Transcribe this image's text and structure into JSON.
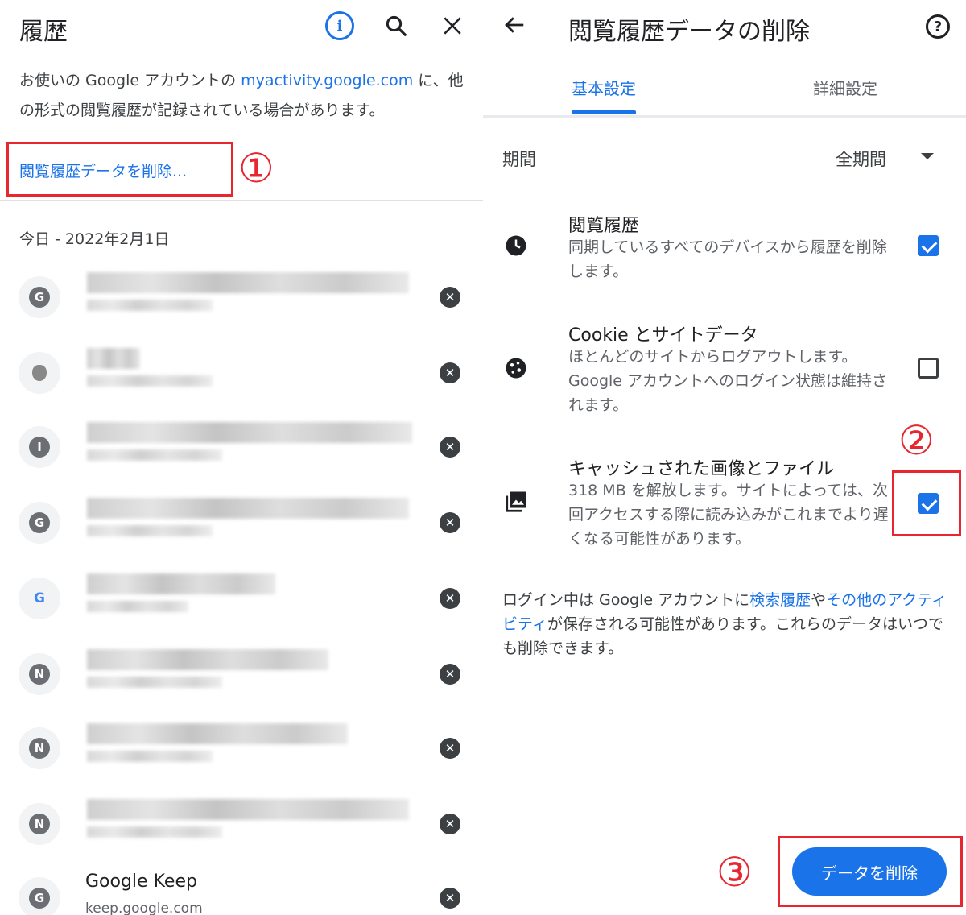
{
  "left": {
    "title": "履歴",
    "notice_pre": "お使いの Google アカウントの ",
    "notice_link": "myactivity.google.com",
    "notice_post": " に、他の形式の閲覧履歴が記録されている場合があります。",
    "clear_link": "閲覧履歴データを削除...",
    "badge_1": "①",
    "date_header": "今日 - 2022年2月1日",
    "rows": [
      {
        "favicon": "G"
      },
      {
        "favicon": "apple"
      },
      {
        "favicon": "I"
      },
      {
        "favicon": "G"
      },
      {
        "favicon": "google-g"
      },
      {
        "favicon": "N"
      },
      {
        "favicon": "N"
      },
      {
        "favicon": "N"
      }
    ],
    "keep_row": {
      "favicon": "G",
      "title": "Google Keep",
      "url": "keep.google.com"
    }
  },
  "right": {
    "title": "閲覧履歴データの削除",
    "tabs": [
      {
        "label": "基本設定",
        "selected": true
      },
      {
        "label": "詳細設定",
        "selected": false
      }
    ],
    "period_label": "期間",
    "period_value": "全期間",
    "options": [
      {
        "icon": "clock-icon",
        "title": "閲覧履歴",
        "desc": "同期しているすべてのデバイスから履歴を削除します。",
        "checked": true
      },
      {
        "icon": "cookie-icon",
        "title": "Cookie とサイトデータ",
        "desc": "ほとんどのサイトからログアウトします。Google アカウントへのログイン状態は維持されます。",
        "checked": false
      },
      {
        "icon": "image-icon",
        "title": "キャッシュされた画像とファイル",
        "desc": "318 MB を解放します。サイトによっては、次回アクセスする際に読み込みがこれまでより遅くなる可能性があります。",
        "checked": true
      }
    ],
    "badge_2": "②",
    "footer_pre": "ログイン中は Google アカウントに",
    "footer_link1": "検索履歴",
    "footer_mid": "や",
    "footer_link2": "その他のアクティビティ",
    "footer_post": "が保存される可能性があります。これらのデータはいつでも削除できます。",
    "badge_3": "③",
    "delete_button": "データを削除"
  },
  "colors": {
    "accent": "#1a73e8",
    "annotation": "#e8262f"
  }
}
